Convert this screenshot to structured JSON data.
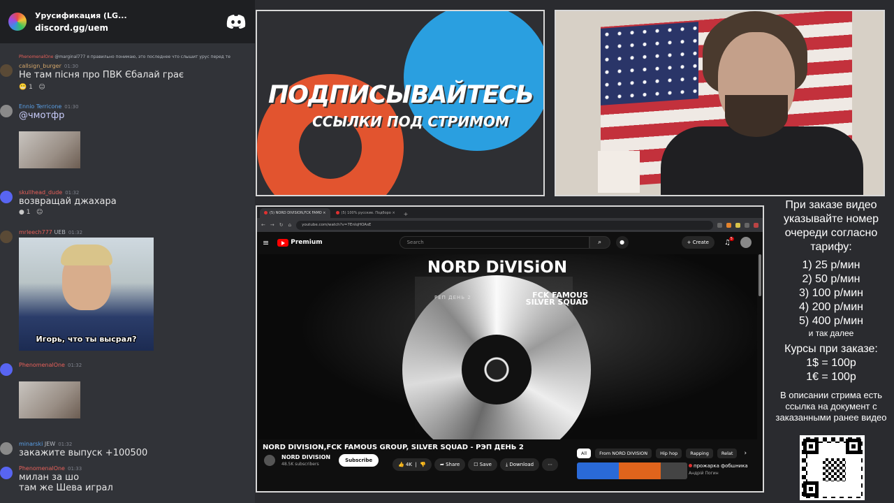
{
  "discord": {
    "server_name": "Урусификация (LG...",
    "invite": "discord.gg/uem"
  },
  "messages": [
    {
      "reply": "@marginal777 я правильно понимаю, это последнее что слышит урус перед те",
      "reply_author": "PhenomenalOne"
    },
    {
      "author": "callsign_burger",
      "time": "01:30",
      "text": "Не там пісня про ПВК Єбалай грає",
      "reaction": "1",
      "author_color": "#d6a86a"
    },
    {
      "author": "Ennio Terricone",
      "time": "01:30",
      "text": "@чмотфр",
      "author_color": "#5aa0e8"
    },
    {
      "author": "skullhead_dude",
      "time": "01:32",
      "text": "возвращай джахара",
      "reaction": "1",
      "author_color": "#e8605a"
    },
    {
      "author": "mrleech777",
      "tag": "UEB",
      "time": "01:32",
      "meme_caption": "Игорь, что ты высрал?",
      "author_color": "#e8605a"
    },
    {
      "author": "PhenomenalOne",
      "time": "01:32",
      "author_color": "#e8605a"
    },
    {
      "author": "minarski",
      "tag": "JEW",
      "time": "01:32",
      "text": "закажите выпуск +100500",
      "author_color": "#5aa0e8"
    },
    {
      "author": "PhenomenalOne",
      "time": "01:33",
      "text": "милан за шо",
      "text2": "там же Шева играл",
      "author_color": "#e8605a"
    }
  ],
  "promo": {
    "headline": "ПОДПИСЫВАЙТЕСЬ",
    "subline": "ССЫЛКИ ПОД СТРИМОМ"
  },
  "browser": {
    "tab1": "(5) NORD DIVISION,FCK FAMO",
    "tab2": "(5) 100% русские. Подборо",
    "url": "youtube.com/watch?v=7EnIqHOAsE",
    "search_placeholder": "Search",
    "premium": "Premium",
    "create": "+ Create",
    "notif_count": "5"
  },
  "video": {
    "cover_title": "NORD DiVISiON",
    "cover_sub": "РЕП ДЕНЬ 2",
    "cover_side": "FCK FAMOUS SILVER SQUAD",
    "title": "NORD DIVISION,FCK FAMOUS GROUP, SILVER SQUAD - РЭП ДЕНЬ 2",
    "channel": "NORD DIVISION",
    "subs": "48.5K subscribers",
    "subscribe": "Subscribe",
    "likes": "4K",
    "share": "Share",
    "save": "Save",
    "download": "Download",
    "chips": [
      "All",
      "From NORD DIVISION",
      "Hip hop",
      "Rapping",
      "Relat"
    ],
    "rec_title": "прожарка фобшника",
    "rec_channel": "Андрій Погин"
  },
  "info": {
    "head": "При заказе видео указывайте номер очереди согласно тарифу:",
    "tariffs": [
      "1) 25 р/мин",
      "2) 50 р/мин",
      "3) 100 р/мин",
      "4) 200 р/мин",
      "5) 400 р/мин"
    ],
    "etc": "и так далее",
    "courses_title": "Курсы при заказе:",
    "usd": "1$ = 100р",
    "eur": "1€ = 100р",
    "desc": "В описании стрима есть ссылка на документ с заказанными ранее видео"
  }
}
